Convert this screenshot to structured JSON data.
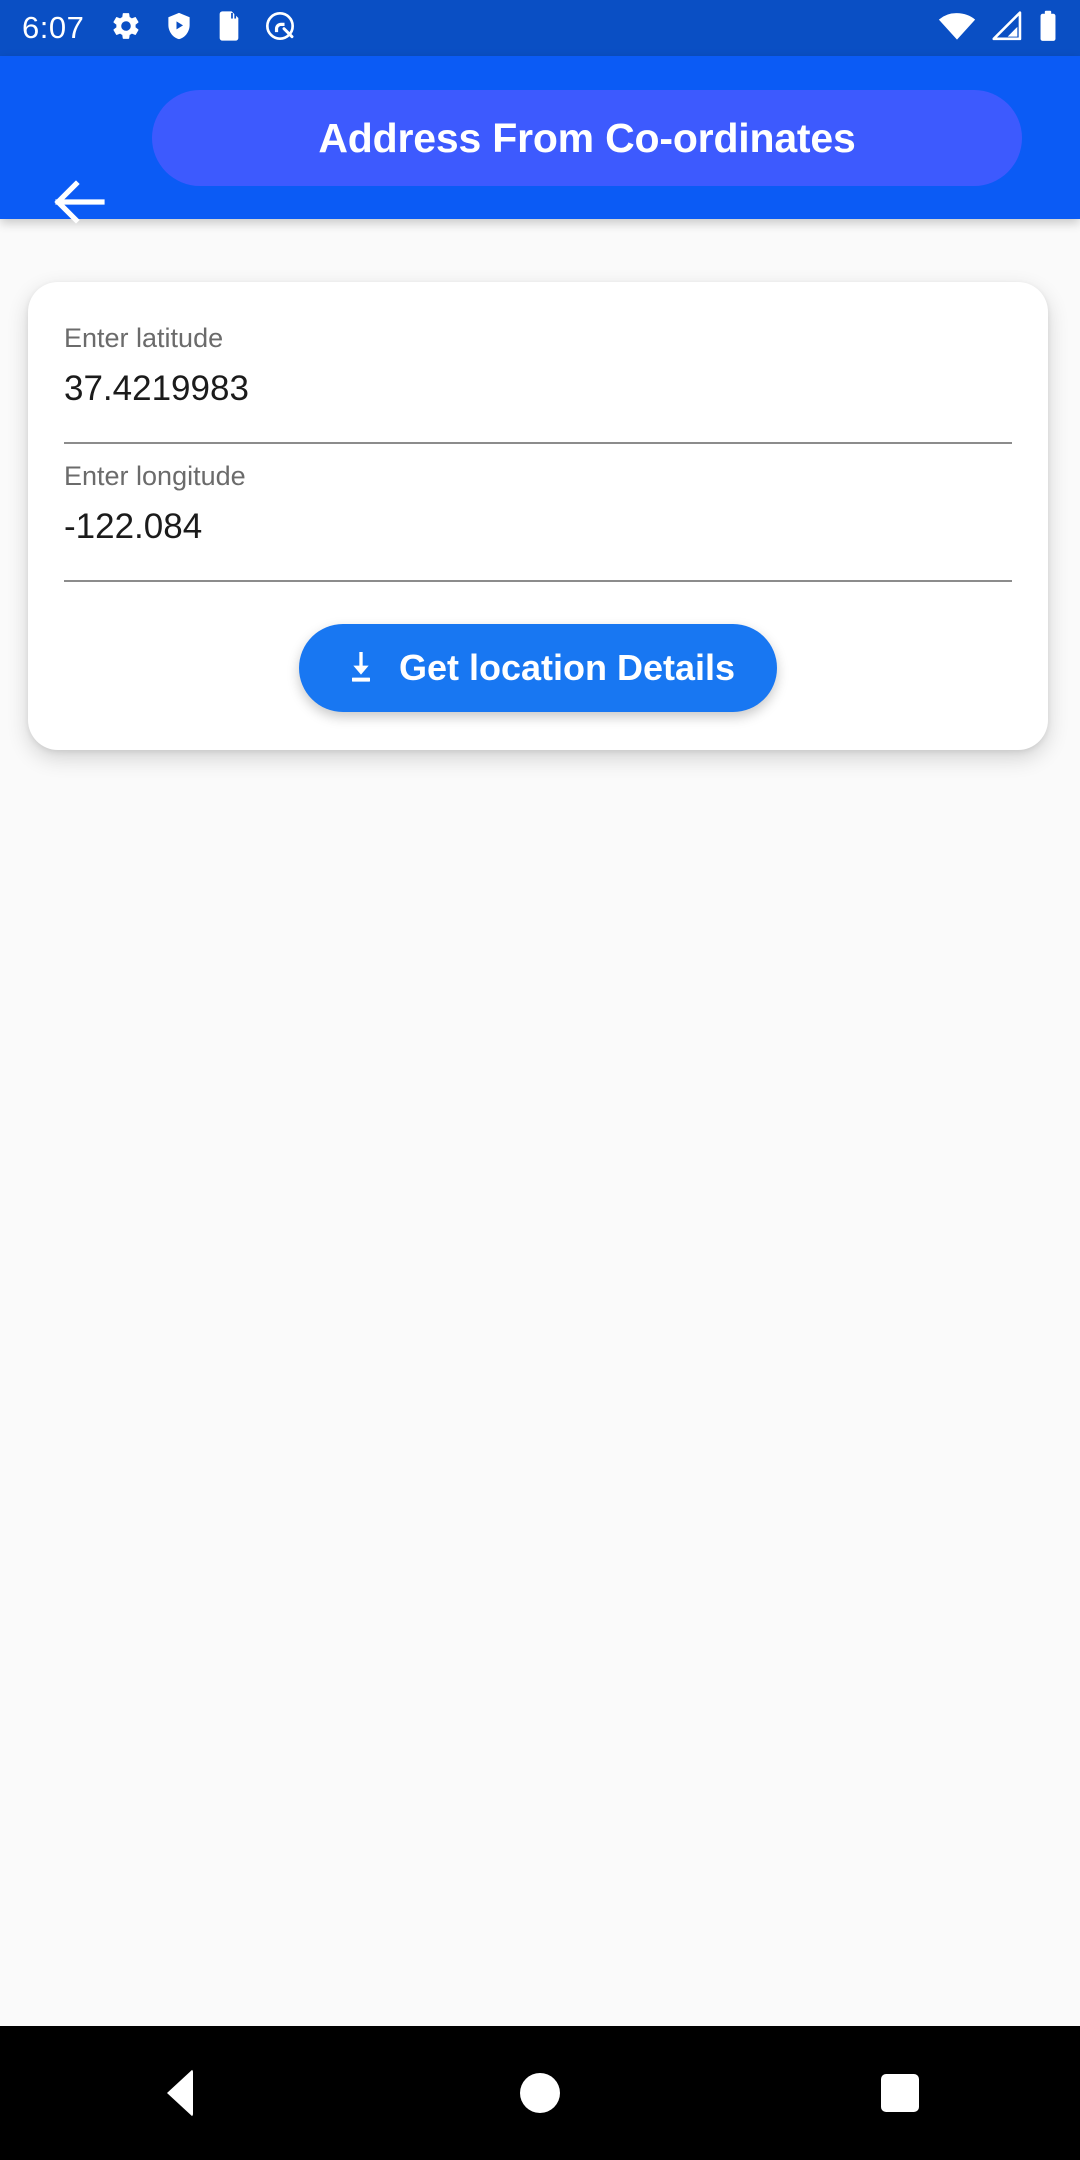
{
  "status_bar": {
    "time": "6:07",
    "background_color": "#0a4fc4",
    "left_icons": [
      "gear-icon",
      "play-protect-shield-icon",
      "sd-card-icon",
      "quick-capture-icon"
    ],
    "right_icons": [
      "wifi-icon",
      "cellular-signal-icon",
      "battery-icon"
    ]
  },
  "app_bar": {
    "background_color": "#0b5bf5",
    "pill_color": "#3d5afe",
    "back_icon": "arrow-left-icon",
    "title": "Address From Co-ordinates"
  },
  "form": {
    "latitude": {
      "label": "Enter latitude",
      "value": "37.4219983",
      "placeholder": "Enter latitude"
    },
    "longitude": {
      "label": "Enter longitude",
      "value": "-122.084",
      "placeholder": "Enter longitude"
    },
    "submit": {
      "label": "Get location Details",
      "icon": "download-icon",
      "color": "#1877f2"
    }
  },
  "nav_bar": {
    "background_color": "#000000",
    "buttons": [
      "back-triangle-icon",
      "home-circle-icon",
      "recents-square-icon"
    ]
  }
}
